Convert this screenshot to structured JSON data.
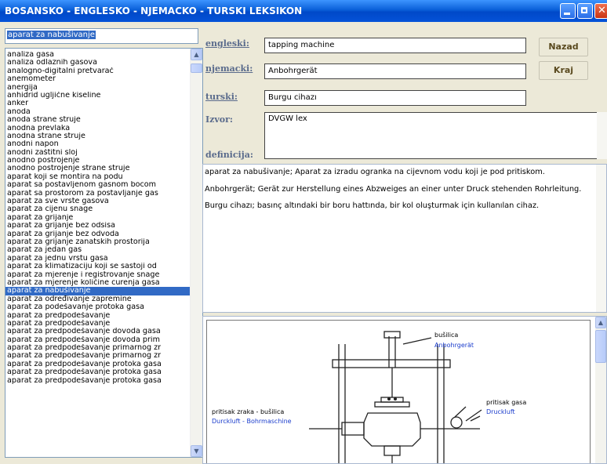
{
  "window": {
    "title": "BOSANSKO - ENGLESKO - NJEMACKO - TURSKI LEKSIKON",
    "minimize_glyph": "▁",
    "maximize_glyph": "□",
    "close_glyph": "✕"
  },
  "search": {
    "value": "aparat za nabušivanje"
  },
  "terms": [
    "analiza gasa",
    "analiza odlaznih gasova",
    "analogno-digitalni pretvarač",
    "anemometer",
    "anergija",
    "anhidrid ugljične kiseline",
    "anker",
    "anoda",
    "anoda strane struje",
    "anodna prevlaka",
    "anodna strane struje",
    "anodni napon",
    "anodni zaštitni sloj",
    "anodno postrojenje",
    "anodno postrojenje strane struje",
    "aparat koji se montira na podu",
    "aparat sa postavljenom gasnom bocom",
    "aparat sa prostorom za postavljanje gas",
    "aparat za  sve vrste  gasova",
    "aparat za cijenu snage",
    "aparat za grijanje",
    "aparat za grijanje bez odsisa",
    "aparat za grijanje bez odvoda",
    "aparat za grijanje zanatskih prostorija",
    "aparat za jedan gas",
    "aparat za jednu vrstu  gasa",
    "aparat za klimatizaciju koji se sastoji od",
    "aparat za mjerenje i registrovanje snage",
    "aparat za mjerenje količine curenja gasa",
    "aparat za nabušivanje",
    "aparat za određivanje zapremine",
    "aparat za podešavanje protoka gasa",
    "aparat za predpodešavanje",
    "aparat za predpodešavanje",
    "aparat za predpodešavanje dovoda gasa",
    "aparat za predpodešavanje dovoda prim",
    "aparat za predpodešavanje primarnog zr",
    "aparat za predpodešavanje primarnog zr",
    "aparat za predpodešavanje protoka gasa",
    "aparat za predpodešavanje protoka gasa",
    "aparat za predpodešavanje protoka gasa"
  ],
  "selected_term_index": 29,
  "fields": {
    "engleski_label": "engleski:",
    "engleski_value": "tapping machine",
    "njemacki_label": "njemacki:",
    "njemacki_value": "Anbohrgerät",
    "turski_label": "turski:",
    "turski_value": "Burgu cihazı",
    "izvor_label": "Izvor:",
    "izvor_value": "DVGW lex",
    "definicija_label": "definicija:"
  },
  "buttons": {
    "back": "Nazad",
    "end": "Kraj"
  },
  "definition": [
    "aparat za nabušivanje; Aparat za izradu ogranka na cijevnom vodu koji je pod pritiskom.",
    "Anbohrgerät; Gerät zur Herstellung eines Abzweiges an einer unter Druck stehenden Rohrleitung.",
    "Burgu cihazı; basınç altındaki bir boru hattında, bir kol oluşturmak için kullanılan cihaz."
  ],
  "diagram": {
    "top_label": "bušilica",
    "top_label_de": "Anbohrgerät",
    "right_label": "pritisak gasa",
    "right_label_de": "Druckluft",
    "left_label": "pritisak zraka - bušilica",
    "left_label_de": "Durckluft - Bohrmaschine"
  },
  "icons": {
    "scroll_up": "▲",
    "scroll_down": "▼"
  }
}
